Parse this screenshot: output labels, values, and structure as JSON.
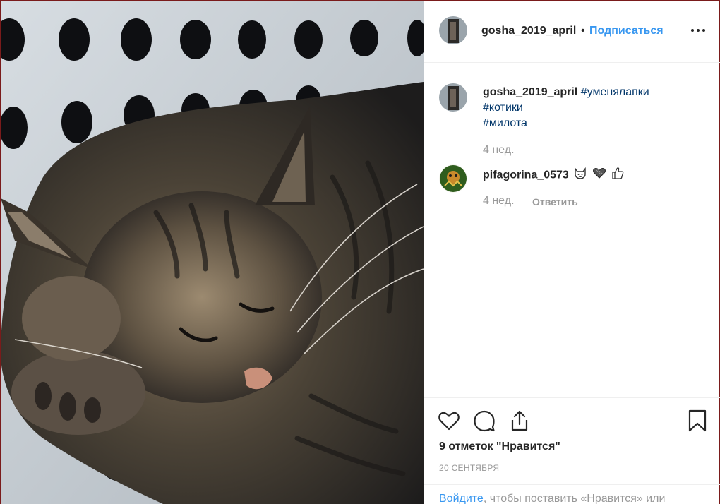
{
  "post": {
    "author": "gosha_2019_april",
    "separator": "•",
    "follow_label": "Подписаться",
    "more_icon": "more-horizontal-icon"
  },
  "caption": {
    "author": "gosha_2019_april",
    "tags": [
      "#уменялапки",
      "#котики",
      "#милота"
    ],
    "time": "4 нед."
  },
  "comment": {
    "author": "pifagorina_0573",
    "emoji_icons": [
      "cat-face-icon",
      "heart-icon",
      "thumbs-up-icon"
    ],
    "time": "4 нед.",
    "reply_label": "Ответить"
  },
  "actions": {
    "like_icon": "heart-outline-icon",
    "comment_icon": "comment-bubble-icon",
    "share_icon": "share-icon",
    "save_icon": "bookmark-icon"
  },
  "likes_text": "9 отметок \"Нравится\"",
  "date_text": "20 СЕНТЯБРЯ",
  "login": {
    "link": "Войдите",
    "rest": ", чтобы поставить «Нравится» или"
  },
  "colors": {
    "link_blue": "#3897f0",
    "hashtag": "#003569",
    "muted": "#999999",
    "text": "#262626"
  }
}
